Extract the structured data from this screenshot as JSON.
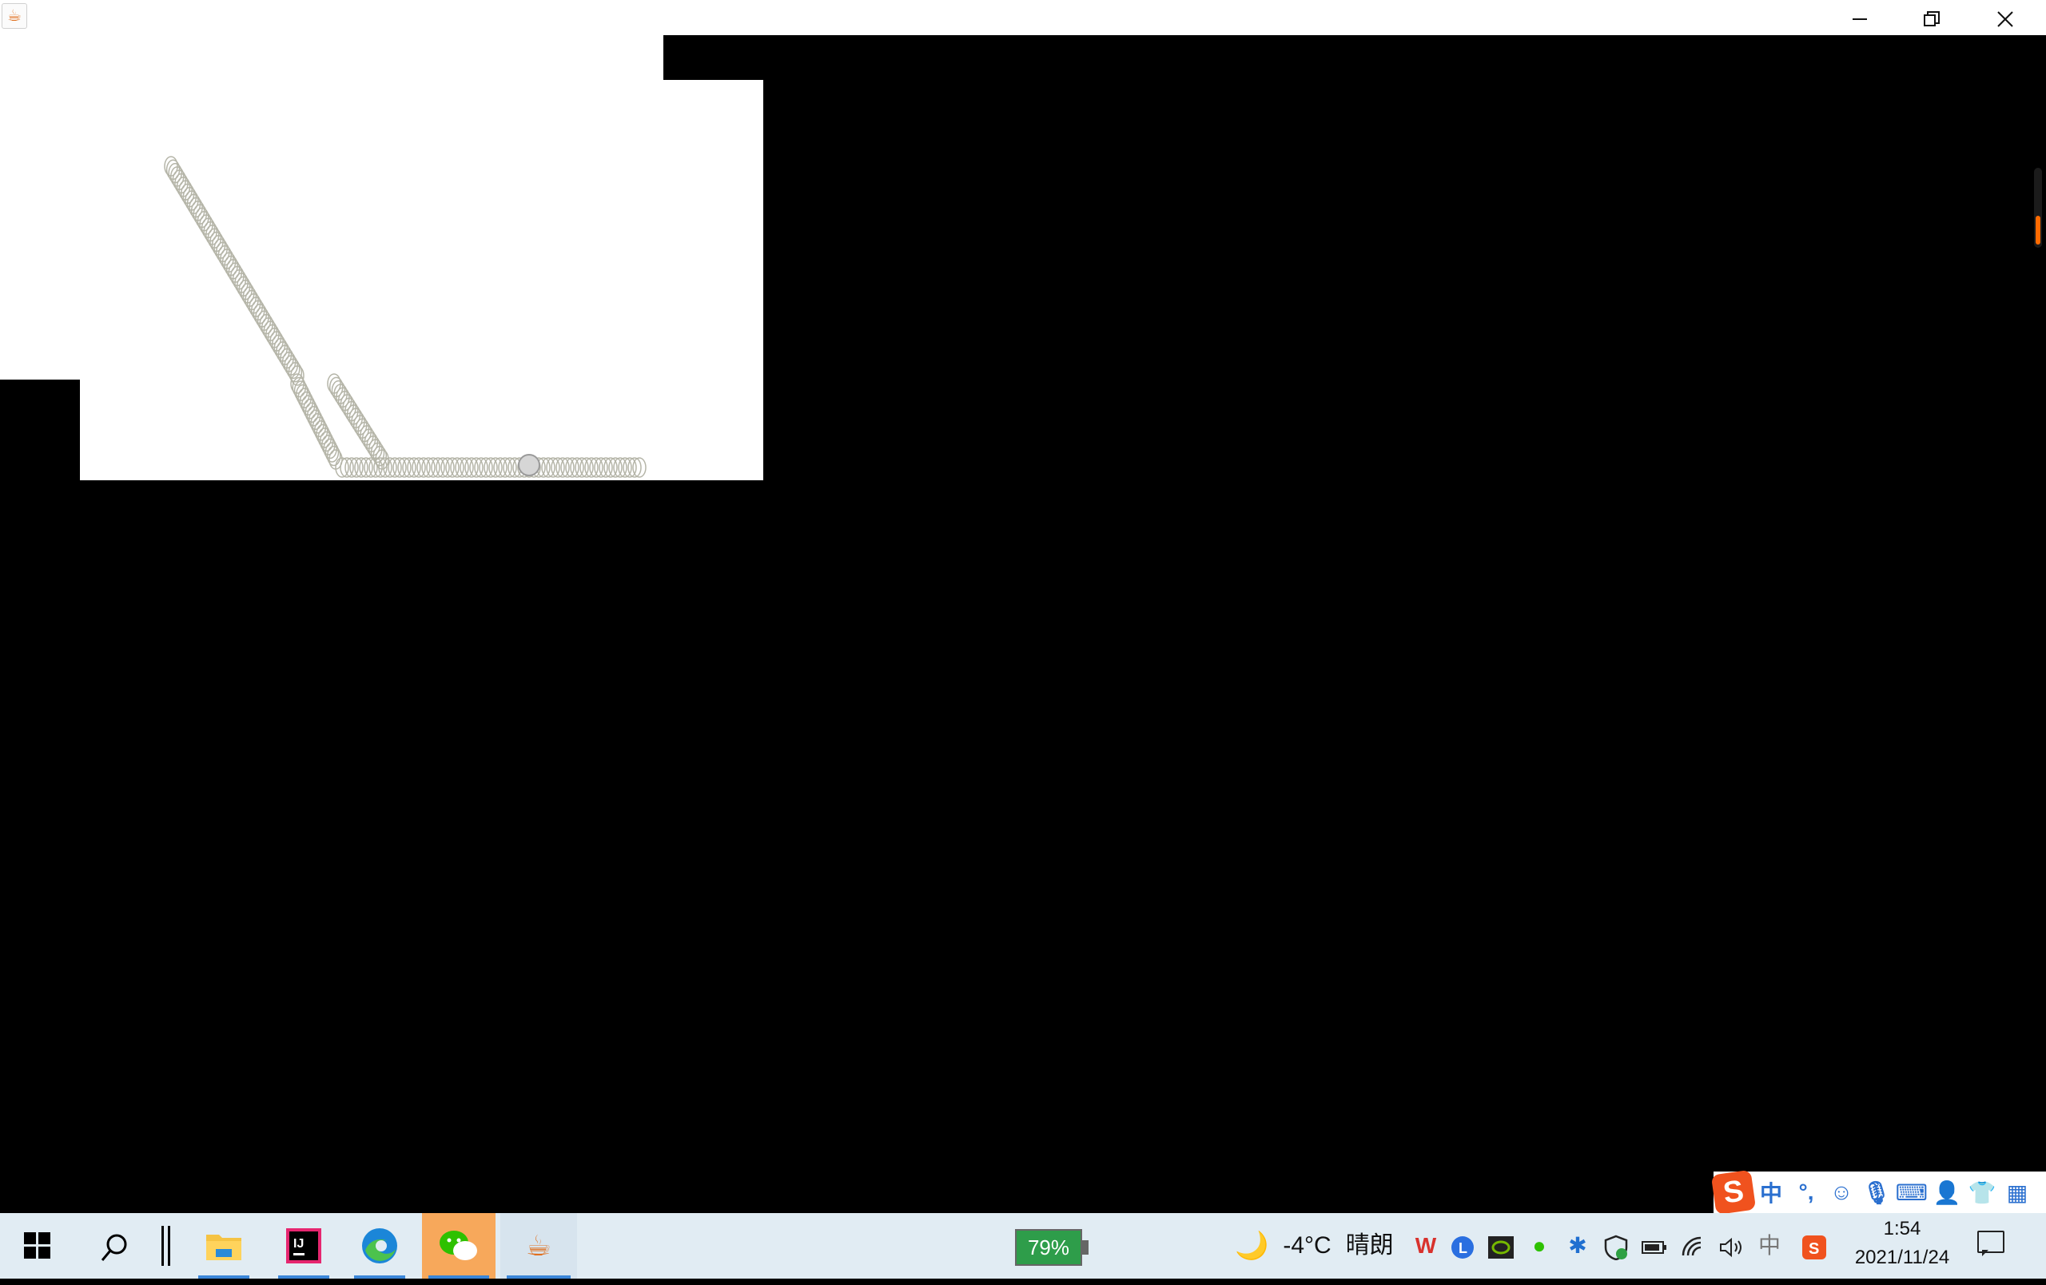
{
  "window": {
    "title": "",
    "app_icon": "java-icon",
    "controls": [
      "minimize-icon",
      "restore-icon",
      "close-icon"
    ]
  },
  "canvas": {
    "background": "#ffffff",
    "trail_color": "#b5b5a8",
    "ball_color": "#cfcfcf"
  },
  "ime_toolbar": {
    "logo": "S",
    "items": [
      {
        "name": "ime-mode-chinese",
        "label": "中"
      },
      {
        "name": "ime-punctuation",
        "label": "°,"
      },
      {
        "name": "ime-emoji-icon",
        "label": "☺"
      },
      {
        "name": "ime-voice-icon",
        "label": "🎙"
      },
      {
        "name": "ime-keyboard-icon",
        "label": "⌨"
      },
      {
        "name": "ime-user-icon",
        "label": "👤"
      },
      {
        "name": "ime-skin-icon",
        "label": "👕"
      },
      {
        "name": "ime-tools-icon",
        "label": "▦"
      }
    ]
  },
  "taskbar": {
    "battery_widget": "79%",
    "weather": {
      "temp": "-4°C",
      "condition": "晴朗"
    },
    "tray_ime": "中",
    "clock": {
      "time": "1:54",
      "date": "2021/11/24"
    },
    "accent": "#3b86d8"
  }
}
